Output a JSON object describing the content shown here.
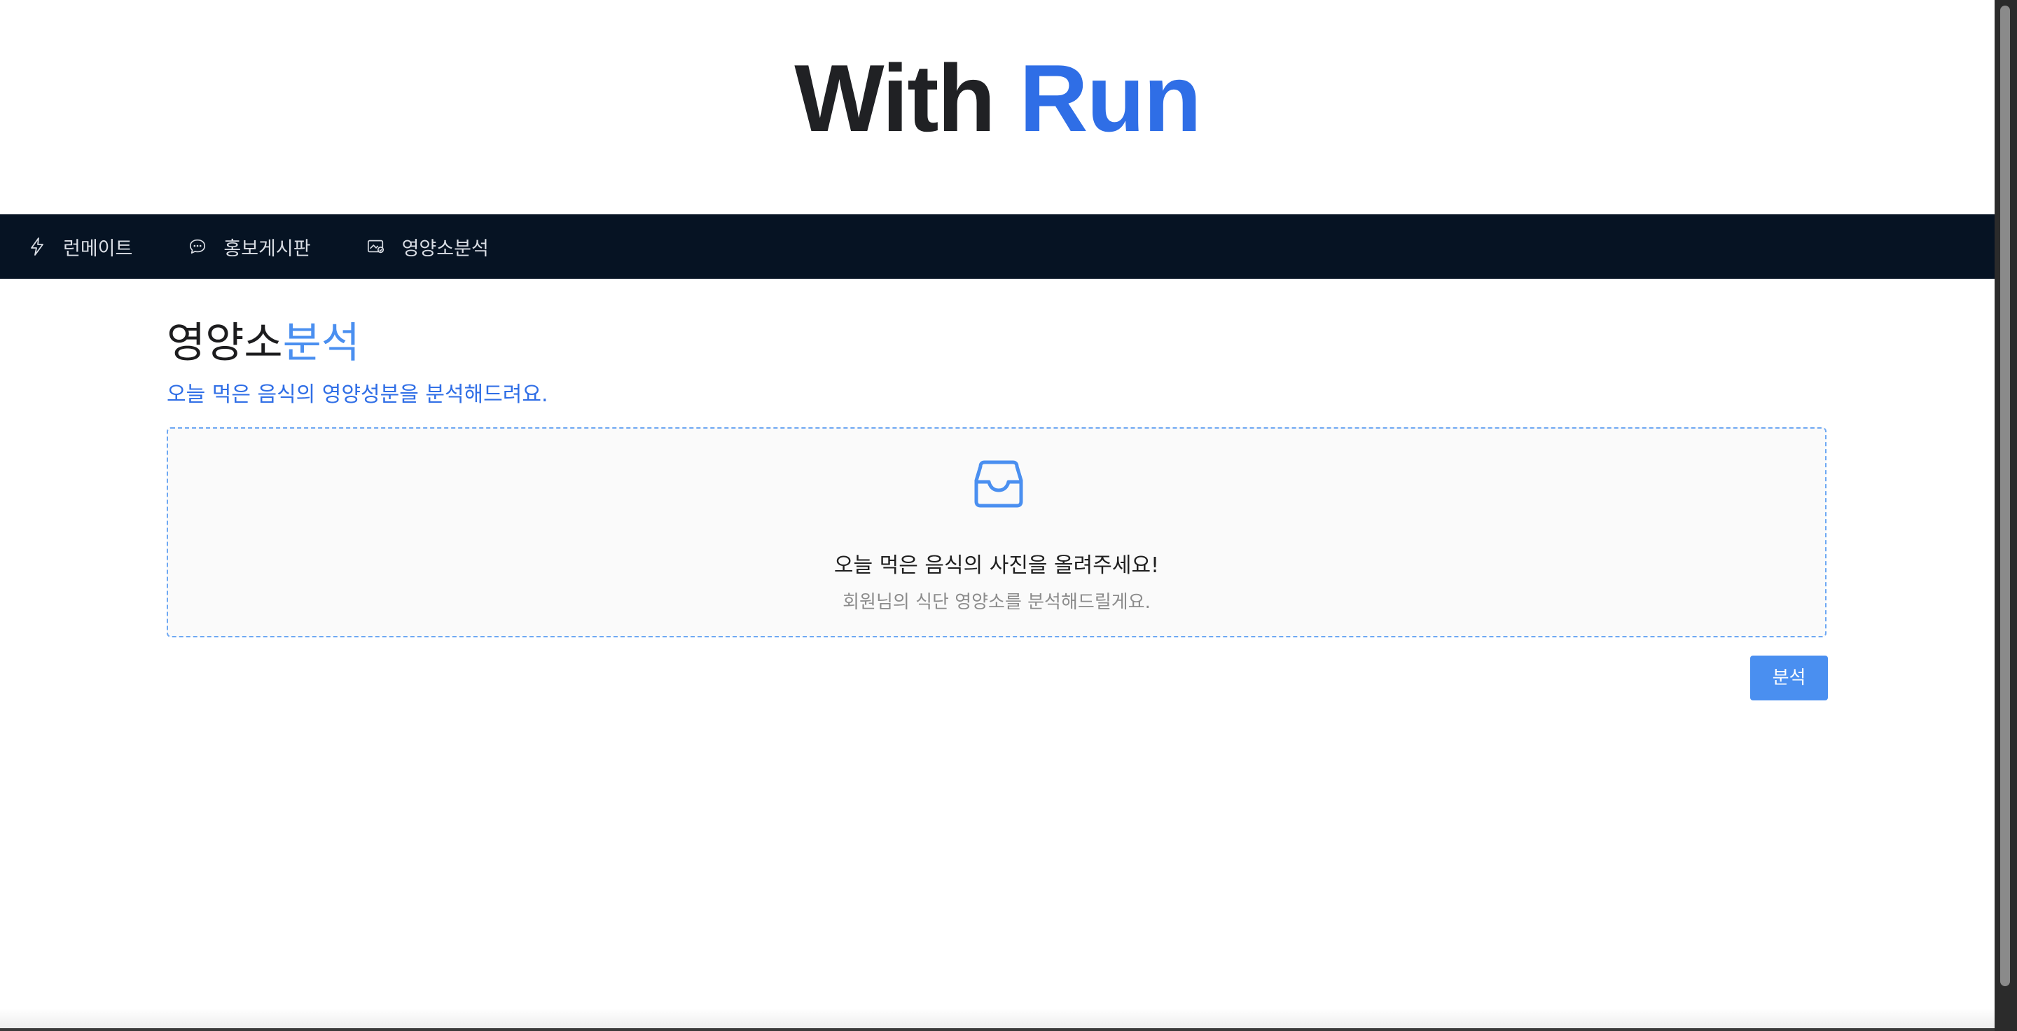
{
  "brand": {
    "part1": "With",
    "part2": "Run",
    "accent_color": "#2f6ee6"
  },
  "nav": {
    "items": [
      {
        "label": "런메이트",
        "icon": "lightning-icon"
      },
      {
        "label": "홍보게시판",
        "icon": "chat-bubble-icon"
      },
      {
        "label": "영양소분석",
        "icon": "image-analysis-icon"
      }
    ],
    "background": "#061323"
  },
  "page": {
    "title_part1": "영양소",
    "title_part2": "분석",
    "subtitle": "오늘 먹은 음식의 영양성분을 분석해드려요."
  },
  "upload": {
    "icon": "inbox-icon",
    "main_text": "오늘 먹은 음식의 사진을 올려주세요!",
    "hint_text": "회원님의 식단 영양소를 분석해드릴게요."
  },
  "actions": {
    "analyze_label": "분석",
    "button_color": "#4a8ff0"
  }
}
